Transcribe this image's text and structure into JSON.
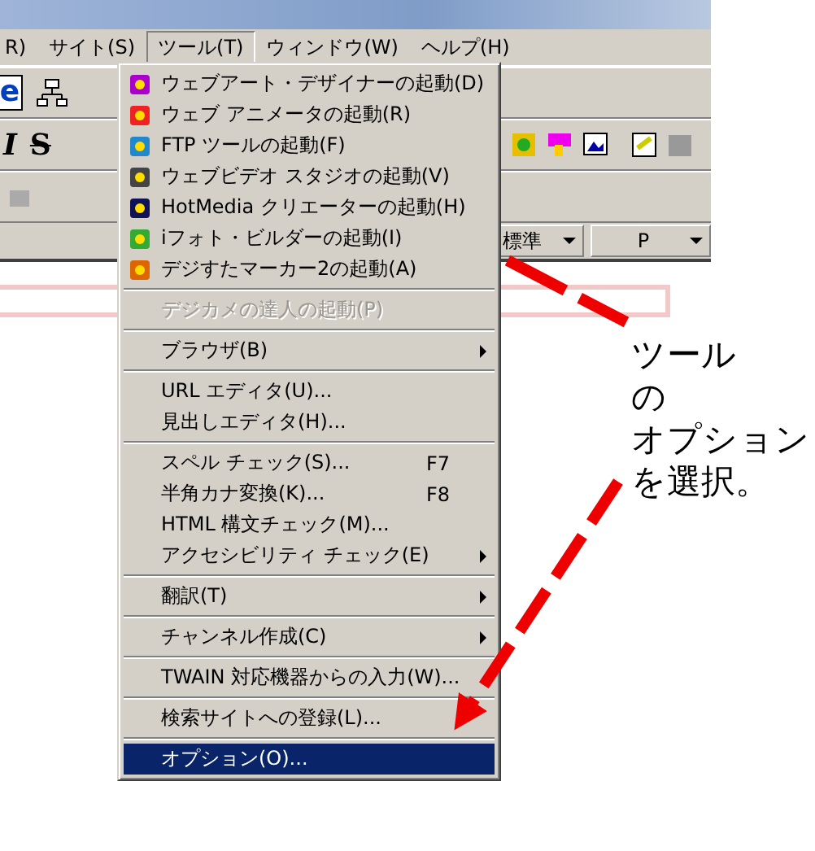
{
  "menubar": [
    {
      "label": "R)",
      "selected": false
    },
    {
      "label": "サイト(S)",
      "selected": false
    },
    {
      "label": "ツール(T)",
      "selected": true
    },
    {
      "label": "ウィンドウ(W)",
      "selected": false
    },
    {
      "label": "ヘルプ(H)",
      "selected": false
    }
  ],
  "toolbar": {
    "browser_button": "e",
    "italic_button": "I",
    "strike_button": "S"
  },
  "format_bar": {
    "style_dropdown": "標準",
    "tag_dropdown": "P"
  },
  "menu": {
    "groups": [
      [
        {
          "label": "ウェブアート・デザイナーの起動(D)",
          "icon": true,
          "disabled": false,
          "submenu": false,
          "selected": false
        },
        {
          "label": "ウェブ アニメータの起動(R)",
          "icon": true,
          "disabled": false,
          "submenu": false,
          "selected": false
        },
        {
          "label": "FTP ツールの起動(F)",
          "icon": true,
          "disabled": false,
          "submenu": false,
          "selected": false
        },
        {
          "label": "ウェブビデオ スタジオの起動(V)",
          "icon": true,
          "disabled": false,
          "submenu": false,
          "selected": false
        },
        {
          "label": "HotMedia クリエーターの起動(H)",
          "icon": true,
          "disabled": false,
          "submenu": false,
          "selected": false
        },
        {
          "label": "iフォト・ビルダーの起動(I)",
          "icon": true,
          "disabled": false,
          "submenu": false,
          "selected": false
        },
        {
          "label": "デジすたマーカー2の起動(A)",
          "icon": true,
          "disabled": false,
          "submenu": false,
          "selected": false
        }
      ],
      [
        {
          "label": "デジカメの達人の起動(P)",
          "icon": false,
          "disabled": true,
          "submenu": false,
          "selected": false
        }
      ],
      [
        {
          "label": "ブラウザ(B)",
          "icon": false,
          "disabled": false,
          "submenu": true,
          "selected": false
        }
      ],
      [
        {
          "label": "URL エディタ(U)...",
          "icon": false,
          "disabled": false,
          "submenu": false,
          "selected": false
        },
        {
          "label": "見出しエディタ(H)...",
          "icon": false,
          "disabled": false,
          "submenu": false,
          "selected": false
        }
      ],
      [
        {
          "label": "スペル チェック(S)...",
          "shortcut": "F7",
          "icon": false,
          "disabled": false,
          "submenu": false,
          "selected": false
        },
        {
          "label": "半角カナ変換(K)...",
          "shortcut": "F8",
          "icon": false,
          "disabled": false,
          "submenu": false,
          "selected": false
        },
        {
          "label": "HTML 構文チェック(M)...",
          "icon": false,
          "disabled": false,
          "submenu": false,
          "selected": false
        },
        {
          "label": "アクセシビリティ チェック(E)",
          "icon": false,
          "disabled": false,
          "submenu": true,
          "selected": false
        }
      ],
      [
        {
          "label": "翻訳(T)",
          "icon": false,
          "disabled": false,
          "submenu": true,
          "selected": false
        }
      ],
      [
        {
          "label": "チャンネル作成(C)",
          "icon": false,
          "disabled": false,
          "submenu": true,
          "selected": false
        }
      ],
      [
        {
          "label": "TWAIN 対応機器からの入力(W)...",
          "icon": false,
          "disabled": false,
          "submenu": false,
          "selected": false
        }
      ],
      [
        {
          "label": "検索サイトへの登録(L)...",
          "icon": false,
          "disabled": false,
          "submenu": false,
          "selected": false
        }
      ],
      [
        {
          "label": "オプション(O)...",
          "icon": false,
          "disabled": false,
          "submenu": false,
          "selected": true
        }
      ]
    ]
  },
  "annotation": {
    "lines": [
      "ツール",
      "の",
      "オプション",
      "を選択。"
    ]
  }
}
